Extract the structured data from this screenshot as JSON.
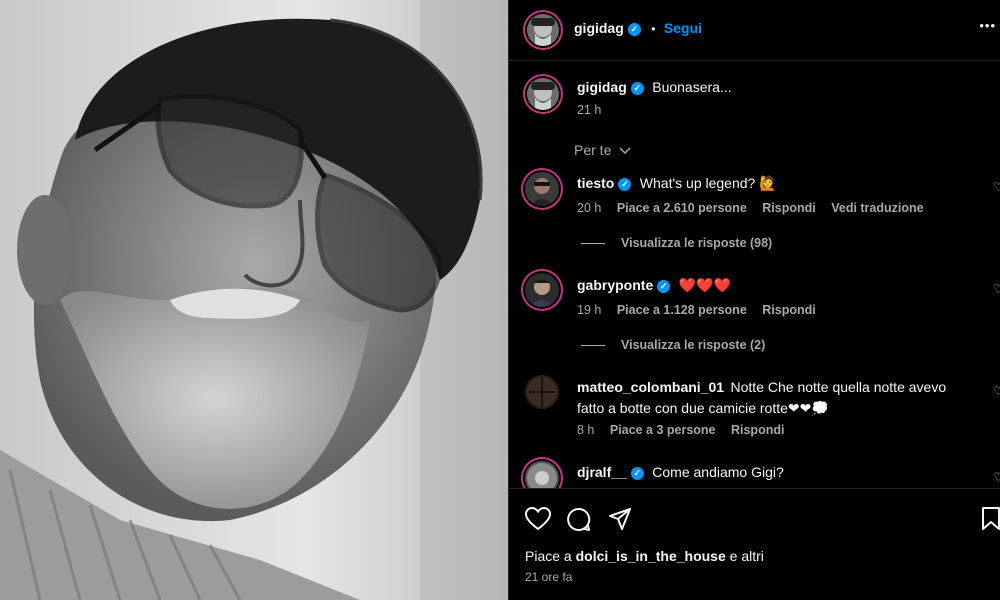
{
  "post": {
    "author": "gigidag",
    "follow_dot": "•",
    "follow_label": "Segui",
    "more_label": "•••",
    "caption": "Buonasera...",
    "caption_time": "21 h"
  },
  "filter": {
    "label": "Per te"
  },
  "comments": [
    {
      "user": "tiesto",
      "verified": true,
      "text": "What's up legend? 🙋",
      "time": "20 h",
      "likes": "Piace a 2.610 persone",
      "reply": "Rispondi",
      "translate": "Vedi traduzione",
      "replies": "Visualizza le risposte (98)"
    },
    {
      "user": "gabryponte",
      "verified": true,
      "text": "❤️❤️❤️",
      "time": "19 h",
      "likes": "Piace a 1.128 persone",
      "reply": "Rispondi",
      "replies": "Visualizza le risposte (2)"
    },
    {
      "user": "matteo_colombani_01",
      "verified": false,
      "text_line1": "Notte Che notte quella notte avevo",
      "text_line2": "fatto a botte con due camicie rotte❤❤💭",
      "time": "8 h",
      "likes": "Piace a 3 persone",
      "reply": "Rispondi"
    },
    {
      "user": "djralf__",
      "verified": true,
      "text": "Come andiamo Gigi?"
    }
  ],
  "likes_summary": {
    "prefix": "Piace a",
    "user": "dolci_is_in_the_house",
    "suffix": "e altri"
  },
  "posted_ago": "21 ore fa",
  "icons": [
    "heart-icon",
    "comment-icon",
    "share-icon",
    "bookmark-icon",
    "verified-icon",
    "chevron-down-icon",
    "more-icon"
  ],
  "colors": {
    "verified": "#0095f6",
    "background": "#000000",
    "secondary_text": "#a8a8a8",
    "heart_red": "#ed4956"
  }
}
